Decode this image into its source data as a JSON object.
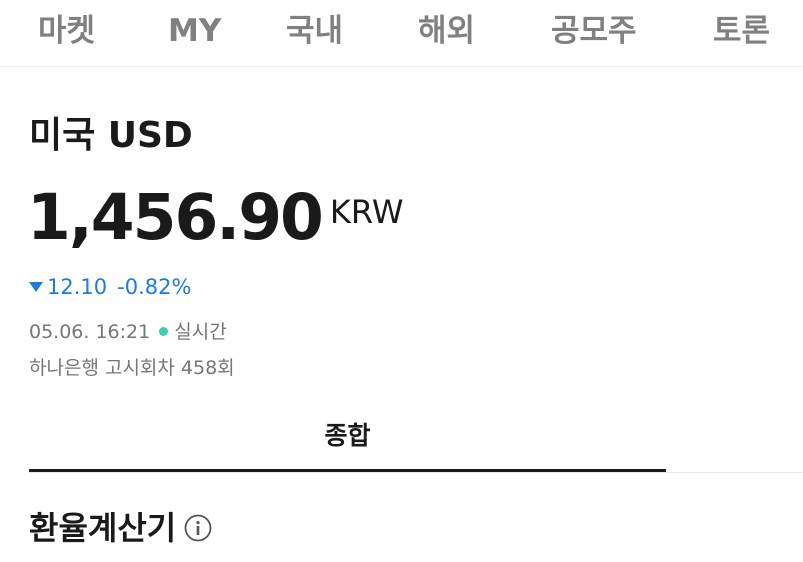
{
  "nav": {
    "items": [
      {
        "label": "마켓"
      },
      {
        "label": "MY"
      },
      {
        "label": "국내"
      },
      {
        "label": "해외"
      },
      {
        "label": "공모주"
      },
      {
        "label": "토론"
      }
    ]
  },
  "header": {
    "title": "미국 USD",
    "price": "1,456.90",
    "currency": "KRW",
    "change_value": "12.10",
    "change_percent": "-0.82%",
    "change_direction": "down",
    "timestamp": "05.06. 16:21",
    "live_label": "실시간",
    "bank_notice": "하나은행 고시회차 458회"
  },
  "tabs": {
    "items": [
      {
        "label": "종합",
        "active": true
      }
    ]
  },
  "section": {
    "title": "환율계산기",
    "info_icon": "info-icon"
  },
  "colors": {
    "down": "#1e7bd9",
    "live_dot": "#3dcfa9",
    "nav_text": "#808080",
    "meta_text": "#767676"
  }
}
